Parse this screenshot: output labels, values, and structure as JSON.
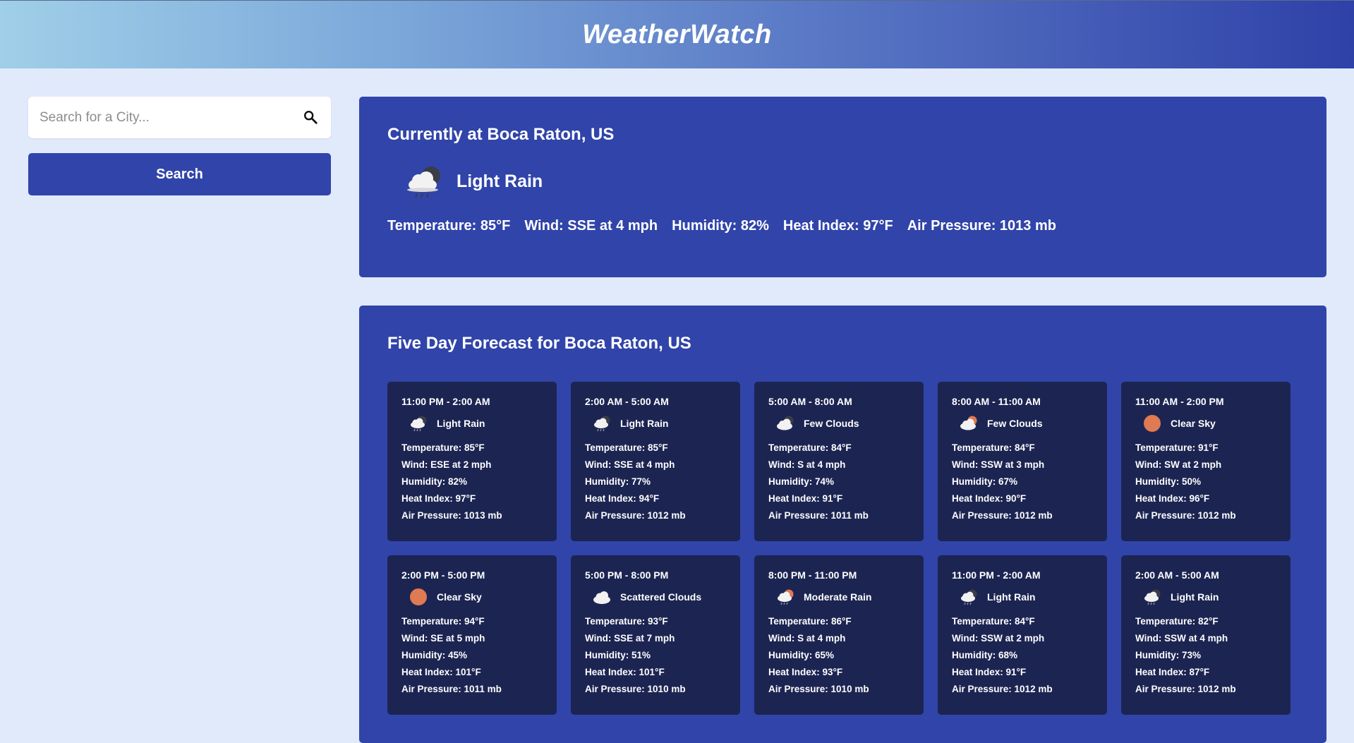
{
  "header": {
    "title": "WeatherWatch"
  },
  "search": {
    "placeholder": "Search for a City...",
    "button_label": "Search"
  },
  "current": {
    "title": "Currently at Boca Raton, US",
    "condition": "Light Rain",
    "icon": "cloud-rain-night-icon",
    "stats": {
      "temperature": "Temperature: 85°F",
      "wind": "Wind: SSE at 4 mph",
      "humidity": "Humidity: 82%",
      "heat_index": "Heat Index: 97°F",
      "pressure": "Air Pressure: 1013 mb"
    }
  },
  "forecast": {
    "title": "Five Day Forecast for Boca Raton, US",
    "cards": [
      {
        "time": "11:00 PM - 2:00 AM",
        "condition": "Light Rain",
        "icon": "rain-night",
        "temperature": "Temperature: 85°F",
        "wind": "Wind: ESE at 2 mph",
        "humidity": "Humidity: 82%",
        "heat_index": "Heat Index: 97°F",
        "pressure": "Air Pressure: 1013 mb"
      },
      {
        "time": "2:00 AM - 5:00 AM",
        "condition": "Light Rain",
        "icon": "rain-night",
        "temperature": "Temperature: 85°F",
        "wind": "Wind: SSE at 4 mph",
        "humidity": "Humidity: 77%",
        "heat_index": "Heat Index: 94°F",
        "pressure": "Air Pressure: 1012 mb"
      },
      {
        "time": "5:00 AM - 8:00 AM",
        "condition": "Few Clouds",
        "icon": "clouds-night",
        "temperature": "Temperature: 84°F",
        "wind": "Wind: S at 4 mph",
        "humidity": "Humidity: 74%",
        "heat_index": "Heat Index: 91°F",
        "pressure": "Air Pressure: 1011 mb"
      },
      {
        "time": "8:00 AM - 11:00 AM",
        "condition": "Few Clouds",
        "icon": "clouds-day",
        "temperature": "Temperature: 84°F",
        "wind": "Wind: SSW at 3 mph",
        "humidity": "Humidity: 67%",
        "heat_index": "Heat Index: 90°F",
        "pressure": "Air Pressure: 1012 mb"
      },
      {
        "time": "11:00 AM - 2:00 PM",
        "condition": "Clear Sky",
        "icon": "sun",
        "temperature": "Temperature: 91°F",
        "wind": "Wind: SW at 2 mph",
        "humidity": "Humidity: 50%",
        "heat_index": "Heat Index: 96°F",
        "pressure": "Air Pressure: 1012 mb"
      },
      {
        "time": "2:00 PM - 5:00 PM",
        "condition": "Clear Sky",
        "icon": "sun",
        "temperature": "Temperature: 94°F",
        "wind": "Wind: SE at 5 mph",
        "humidity": "Humidity: 45%",
        "heat_index": "Heat Index: 101°F",
        "pressure": "Air Pressure: 1011 mb"
      },
      {
        "time": "5:00 PM - 8:00 PM",
        "condition": "Scattered Clouds",
        "icon": "cloud",
        "temperature": "Temperature: 93°F",
        "wind": "Wind: SSE at 7 mph",
        "humidity": "Humidity: 51%",
        "heat_index": "Heat Index: 101°F",
        "pressure": "Air Pressure: 1010 mb"
      },
      {
        "time": "8:00 PM - 11:00 PM",
        "condition": "Moderate Rain",
        "icon": "rain-day",
        "temperature": "Temperature: 86°F",
        "wind": "Wind: S at 4 mph",
        "humidity": "Humidity: 65%",
        "heat_index": "Heat Index: 93°F",
        "pressure": "Air Pressure: 1010 mb"
      },
      {
        "time": "11:00 PM - 2:00 AM",
        "condition": "Light Rain",
        "icon": "rain-night",
        "temperature": "Temperature: 84°F",
        "wind": "Wind: SSW at 2 mph",
        "humidity": "Humidity: 68%",
        "heat_index": "Heat Index: 91°F",
        "pressure": "Air Pressure: 1012 mb"
      },
      {
        "time": "2:00 AM - 5:00 AM",
        "condition": "Light Rain",
        "icon": "rain-night",
        "temperature": "Temperature: 82°F",
        "wind": "Wind: SSW at 4 mph",
        "humidity": "Humidity: 73%",
        "heat_index": "Heat Index: 87°F",
        "pressure": "Air Pressure: 1012 mb"
      }
    ]
  },
  "colors": {
    "panel": "#3144a9",
    "card": "#1c2552",
    "page_bg": "#e1eafb",
    "sun": "#e07a52"
  }
}
